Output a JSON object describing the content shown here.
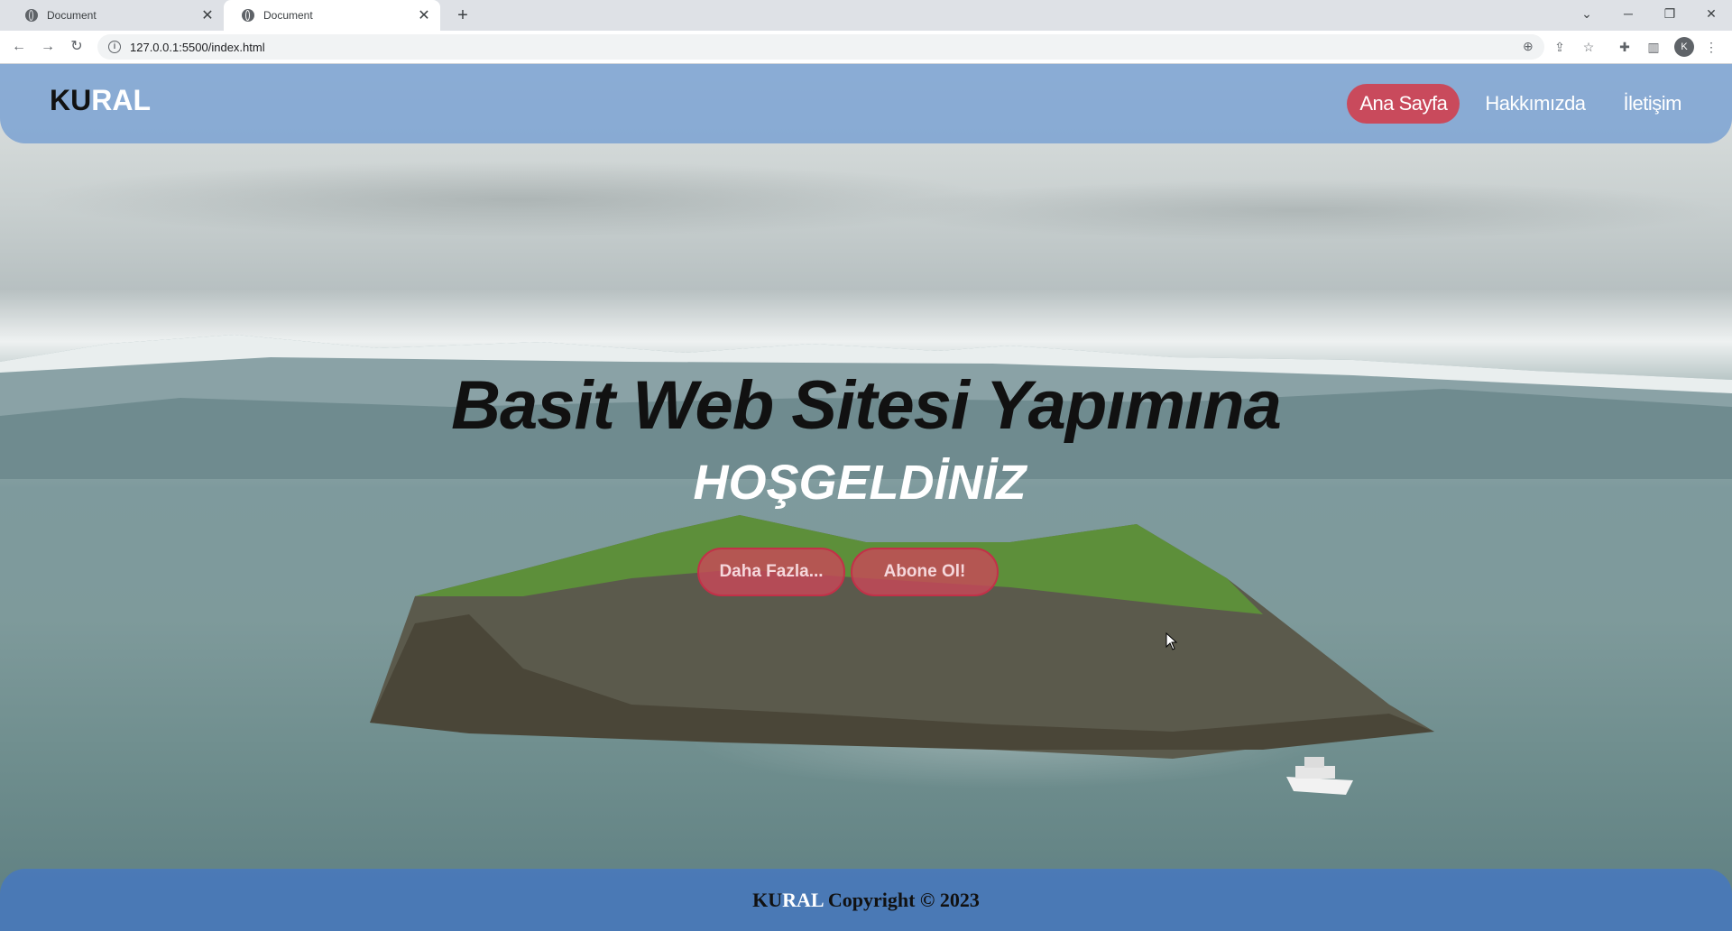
{
  "browser": {
    "tabs": [
      {
        "title": "Document",
        "active": false
      },
      {
        "title": "Document",
        "active": true
      }
    ],
    "new_tab_symbol": "+",
    "address": "127.0.0.1:5500/index.html",
    "profile_initial": "K"
  },
  "site": {
    "brand_part1": "KU",
    "brand_part2": "RAL",
    "nav": [
      {
        "label": "Ana Sayfa",
        "active": true
      },
      {
        "label": "Hakkımızda",
        "active": false
      },
      {
        "label": "İletişim",
        "active": false
      }
    ],
    "hero_title": "Basit Web Sitesi Yapımına",
    "hero_subtitle": "HOŞGELDİNİZ",
    "buttons": {
      "more": "Daha Fazla...",
      "subscribe": "Abone Ol!"
    },
    "footer": {
      "brand_part1": "KU",
      "brand_part2": "RAL",
      "text": " Copyright © 2023"
    }
  },
  "colors": {
    "header_bg": "#78a0d2",
    "active_nav": "#c94a5c",
    "button_bg": "#cd465a",
    "footer_bg": "#4678be"
  }
}
